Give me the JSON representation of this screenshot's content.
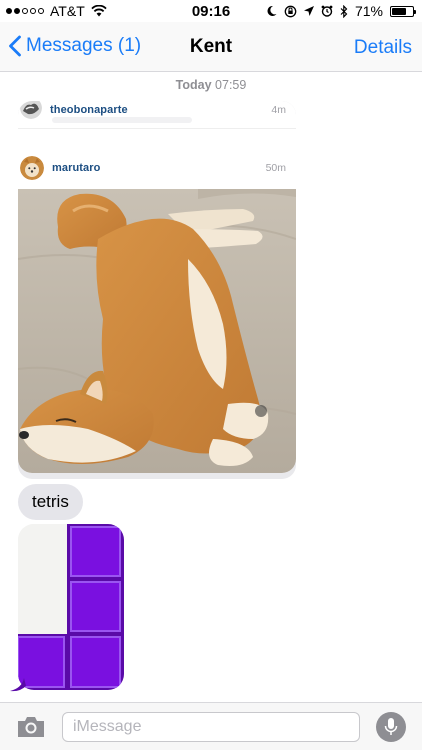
{
  "status_bar": {
    "carrier": "AT&T",
    "time": "09:16",
    "battery": "71%",
    "battery_level": 0.71,
    "signal_dots_filled": 2,
    "signal_dots_total": 5
  },
  "nav": {
    "back_label": "Messages (1)",
    "title": "Kent",
    "details_label": "Details"
  },
  "conversation": {
    "timestamp_day": "Today",
    "timestamp_time": "07:59",
    "shared_post": {
      "posts": [
        {
          "username": "theobonaparte",
          "age": "4m"
        },
        {
          "username": "marutaro",
          "age": "50m"
        }
      ]
    },
    "messages": [
      {
        "type": "text",
        "text": "tetris"
      },
      {
        "type": "sticker",
        "icon": "tetris-blocks"
      }
    ]
  },
  "input": {
    "placeholder": "iMessage"
  },
  "colors": {
    "ios_blue": "#1a7cf8",
    "bubble_gray": "#e5e5ea",
    "tetris_purple": "#7a10e0",
    "username_blue": "#1c4e82"
  }
}
